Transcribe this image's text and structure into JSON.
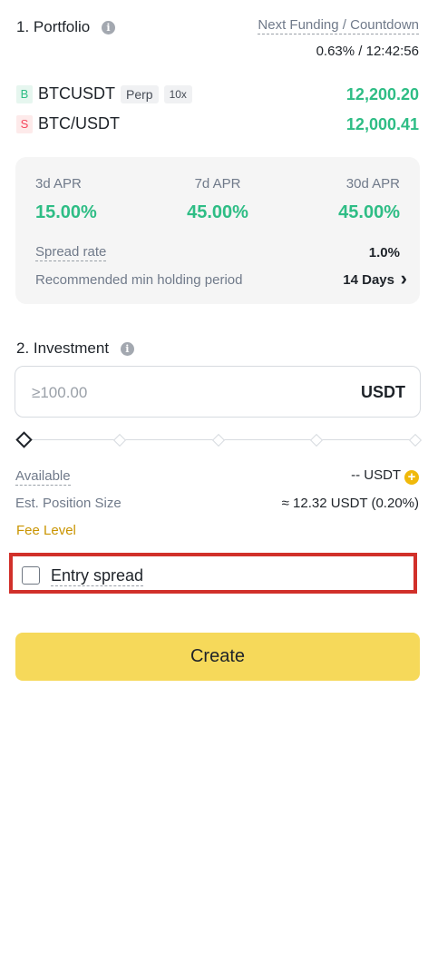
{
  "portfolio": {
    "title": "1. Portfolio",
    "info_icon": "i",
    "funding_label": "Next Funding / Countdown",
    "funding_value": "0.63% / 12:42:56",
    "legs": [
      {
        "badge": "B",
        "symbol": "BTCUSDT",
        "type_tag": "Perp",
        "leverage_tag": "10x",
        "price": "12,200.20"
      },
      {
        "badge": "S",
        "symbol": "BTC/USDT",
        "price": "12,000.41"
      }
    ]
  },
  "apr": {
    "items": [
      {
        "label": "3d APR",
        "value": "15.00%"
      },
      {
        "label": "7d APR",
        "value": "45.00%"
      },
      {
        "label": "30d APR",
        "value": "45.00%"
      }
    ],
    "spread_label": "Spread rate",
    "spread_value": "1.0%",
    "holding_label": "Recommended min holding period",
    "holding_value": "14 Days",
    "holding_chevron": "›"
  },
  "investment": {
    "title": "2. Investment",
    "info_icon": "i",
    "placeholder": "≥100.00",
    "currency": "USDT",
    "slider_percent": 0
  },
  "details": {
    "available_label": "Available",
    "available_value": "-- USDT",
    "est_label": "Est. Position Size",
    "est_value": "≈ 12.32 USDT (0.20%)",
    "fee_level": "Fee Level"
  },
  "entry_spread": {
    "label": "Entry spread",
    "checked": false
  },
  "create_label": "Create",
  "colors": {
    "accent_green": "#2ebd85",
    "buy_badge_bg": "#e6f6ef",
    "sell_badge_bg": "#fdeaea",
    "sell_badge_text": "#f6465d",
    "brand_yellow": "#f0b90b",
    "button_yellow": "#f6d95a",
    "highlight_red": "#d1302a"
  }
}
